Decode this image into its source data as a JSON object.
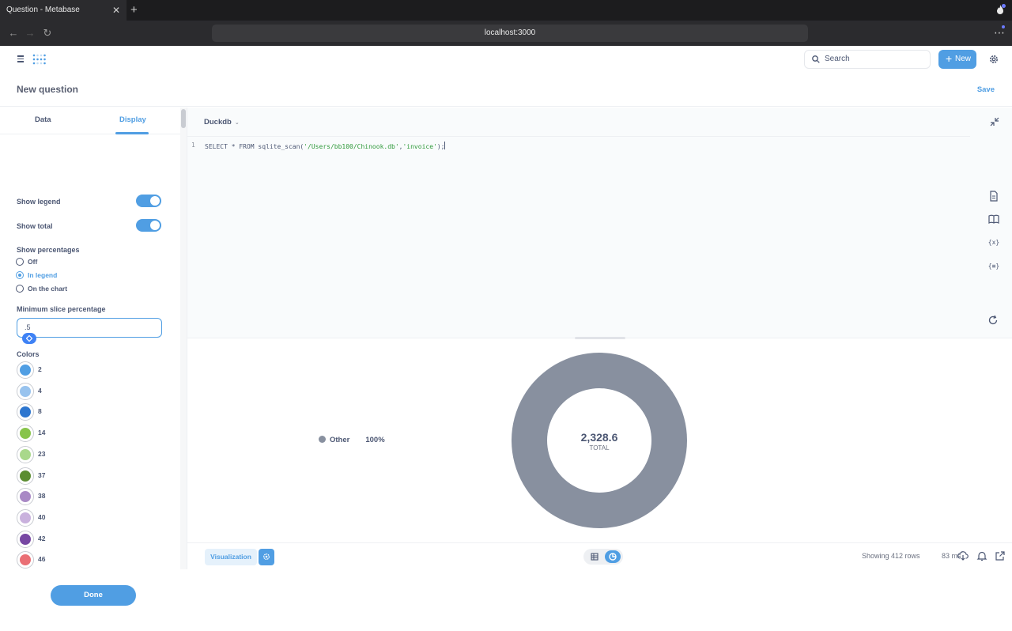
{
  "browser": {
    "tab_title": "Question - Metabase",
    "tab_close": "✕",
    "new_tab": "+",
    "url": "localhost:3000"
  },
  "header": {
    "search_placeholder": "Search",
    "new_label": "New",
    "question_title": "New question",
    "save_label": "Save"
  },
  "sidebar": {
    "tabs": [
      "Data",
      "Display"
    ],
    "active_tab": "Display",
    "show_legend": {
      "label": "Show legend",
      "on": true
    },
    "show_total": {
      "label": "Show total",
      "on": true
    },
    "show_percentages": {
      "label": "Show percentages",
      "options": [
        "Off",
        "In legend",
        "On the chart"
      ],
      "selected": "In legend"
    },
    "min_slice": {
      "label": "Minimum slice percentage",
      "value": ".5"
    },
    "colors_label": "Colors",
    "colors": [
      {
        "label": "2",
        "color": "#509ee3"
      },
      {
        "label": "4",
        "color": "#98c3ee"
      },
      {
        "label": "8",
        "color": "#2d76cf"
      },
      {
        "label": "14",
        "color": "#88c44b"
      },
      {
        "label": "23",
        "color": "#a9d88b"
      },
      {
        "label": "37",
        "color": "#5b8d31"
      },
      {
        "label": "38",
        "color": "#a989c5"
      },
      {
        "label": "40",
        "color": "#c9b1dd"
      },
      {
        "label": "42",
        "color": "#7747a3"
      },
      {
        "label": "46",
        "color": "#ea6f75"
      }
    ],
    "done_label": "Done"
  },
  "editor": {
    "database": "Duckdb",
    "line_number": "1",
    "sql_prefix": "SELECT * FROM sqlite_scan(",
    "sql_arg1": "'/Users/bb100/Chinook.db'",
    "sql_sep": ",",
    "sql_arg2": "'invoice'",
    "sql_suffix": ");"
  },
  "visualization": {
    "legend_label": "Other",
    "legend_percent": "100%",
    "total_value": "2,328.6",
    "total_label": "TOTAL",
    "slice_color": "#88909f"
  },
  "chart_data": {
    "type": "pie",
    "categories": [
      "Other"
    ],
    "values": [
      2328.6
    ],
    "title": "",
    "legend": "left"
  },
  "footer": {
    "visualization_label": "Visualization",
    "rows_label": "Showing 412 rows",
    "time_label": "83 ms"
  },
  "colors": {
    "brand": "#509ee3",
    "text": "#4c5773"
  }
}
